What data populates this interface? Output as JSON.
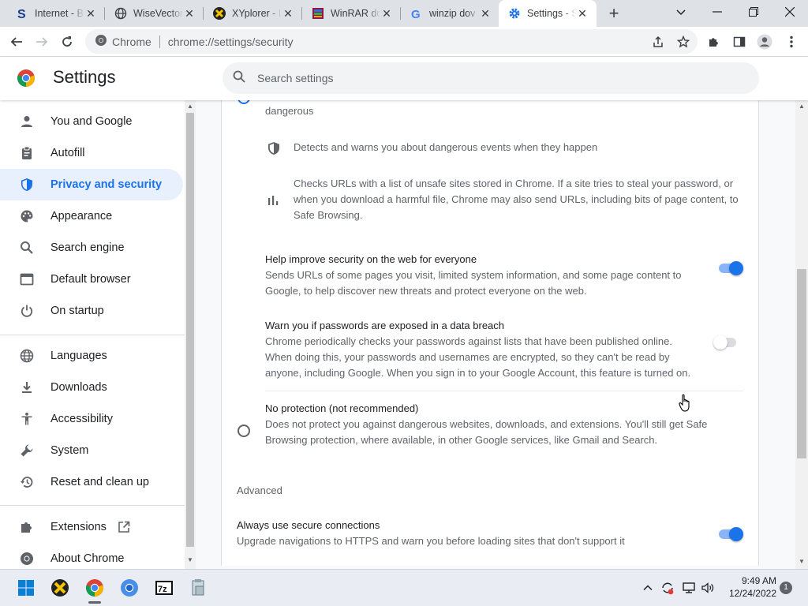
{
  "tabs": [
    {
      "title": "Internet - B",
      "favicon": "s-logo-icon"
    },
    {
      "title": "WiseVector",
      "favicon": "globe-icon"
    },
    {
      "title": "XYplorer - I",
      "favicon": "xyplorer-icon"
    },
    {
      "title": "WinRAR do",
      "favicon": "winrar-icon"
    },
    {
      "title": "winzip dov",
      "favicon": "google-icon"
    },
    {
      "title": "Settings - S",
      "favicon": "gear-icon"
    }
  ],
  "omnibox": {
    "chip": "Chrome",
    "url": "chrome://settings/security"
  },
  "header": {
    "title": "Settings",
    "search_placeholder": "Search settings"
  },
  "sidebar": {
    "items": [
      {
        "label": "You and Google",
        "icon": "person-icon"
      },
      {
        "label": "Autofill",
        "icon": "clipboard-icon"
      },
      {
        "label": "Privacy and security",
        "icon": "shield-icon"
      },
      {
        "label": "Appearance",
        "icon": "palette-icon"
      },
      {
        "label": "Search engine",
        "icon": "search-icon"
      },
      {
        "label": "Default browser",
        "icon": "browser-icon"
      },
      {
        "label": "On startup",
        "icon": "power-icon"
      },
      {
        "label": "Languages",
        "icon": "globe-icon"
      },
      {
        "label": "Downloads",
        "icon": "download-icon"
      },
      {
        "label": "Accessibility",
        "icon": "accessibility-icon"
      },
      {
        "label": "System",
        "icon": "wrench-icon"
      },
      {
        "label": "Reset and clean up",
        "icon": "history-icon"
      },
      {
        "label": "Extensions",
        "icon": "puzzle-icon"
      },
      {
        "label": "About Chrome",
        "icon": "chrome-icon"
      }
    ]
  },
  "content": {
    "top_fragment": "dangerous",
    "features": [
      {
        "icon": "shield-icon",
        "text": "Detects and warns you about dangerous events when they happen"
      },
      {
        "icon": "bar-chart-icon",
        "text": "Checks URLs with a list of unsafe sites stored in Chrome. If a site tries to steal your password, or when you download a harmful file, Chrome may also send URLs, including bits of page content, to Safe Browsing."
      }
    ],
    "help_improve": {
      "title": "Help improve security on the web for everyone",
      "desc": "Sends URLs of some pages you visit, limited system information, and some page content to Google, to help discover new threats and protect everyone on the web.",
      "enabled": true
    },
    "password_warn": {
      "title": "Warn you if passwords are exposed in a data breach",
      "desc": "Chrome periodically checks your passwords against lists that have been published online. When doing this, your passwords and usernames are encrypted, so they can't be read by anyone, including Google. When you sign in to your Google Account, this feature is turned on.",
      "enabled": false
    },
    "no_protection": {
      "title": "No protection (not recommended)",
      "desc": "Does not protect you against dangerous websites, downloads, and extensions. You'll still get Safe Browsing protection, where available, in other Google services, like Gmail and Search.",
      "selected": false
    },
    "advanced_heading": "Advanced",
    "secure_connections": {
      "title": "Always use secure connections",
      "desc": "Upgrade navigations to HTTPS and warn you before loading sites that don't support it",
      "enabled": true
    }
  },
  "taskbar": {
    "apps": [
      "windows-start-icon",
      "xyplorer-icon",
      "chrome-icon",
      "chromium-icon",
      "7zip-icon",
      "installer-icon"
    ],
    "time": "9:49 AM",
    "date": "12/24/2022",
    "notification_count": "1"
  },
  "colors": {
    "accent": "#1a73e8",
    "toggle_on_track": "#8ab4f8",
    "sidebar_active_bg": "#e8f0fe"
  }
}
